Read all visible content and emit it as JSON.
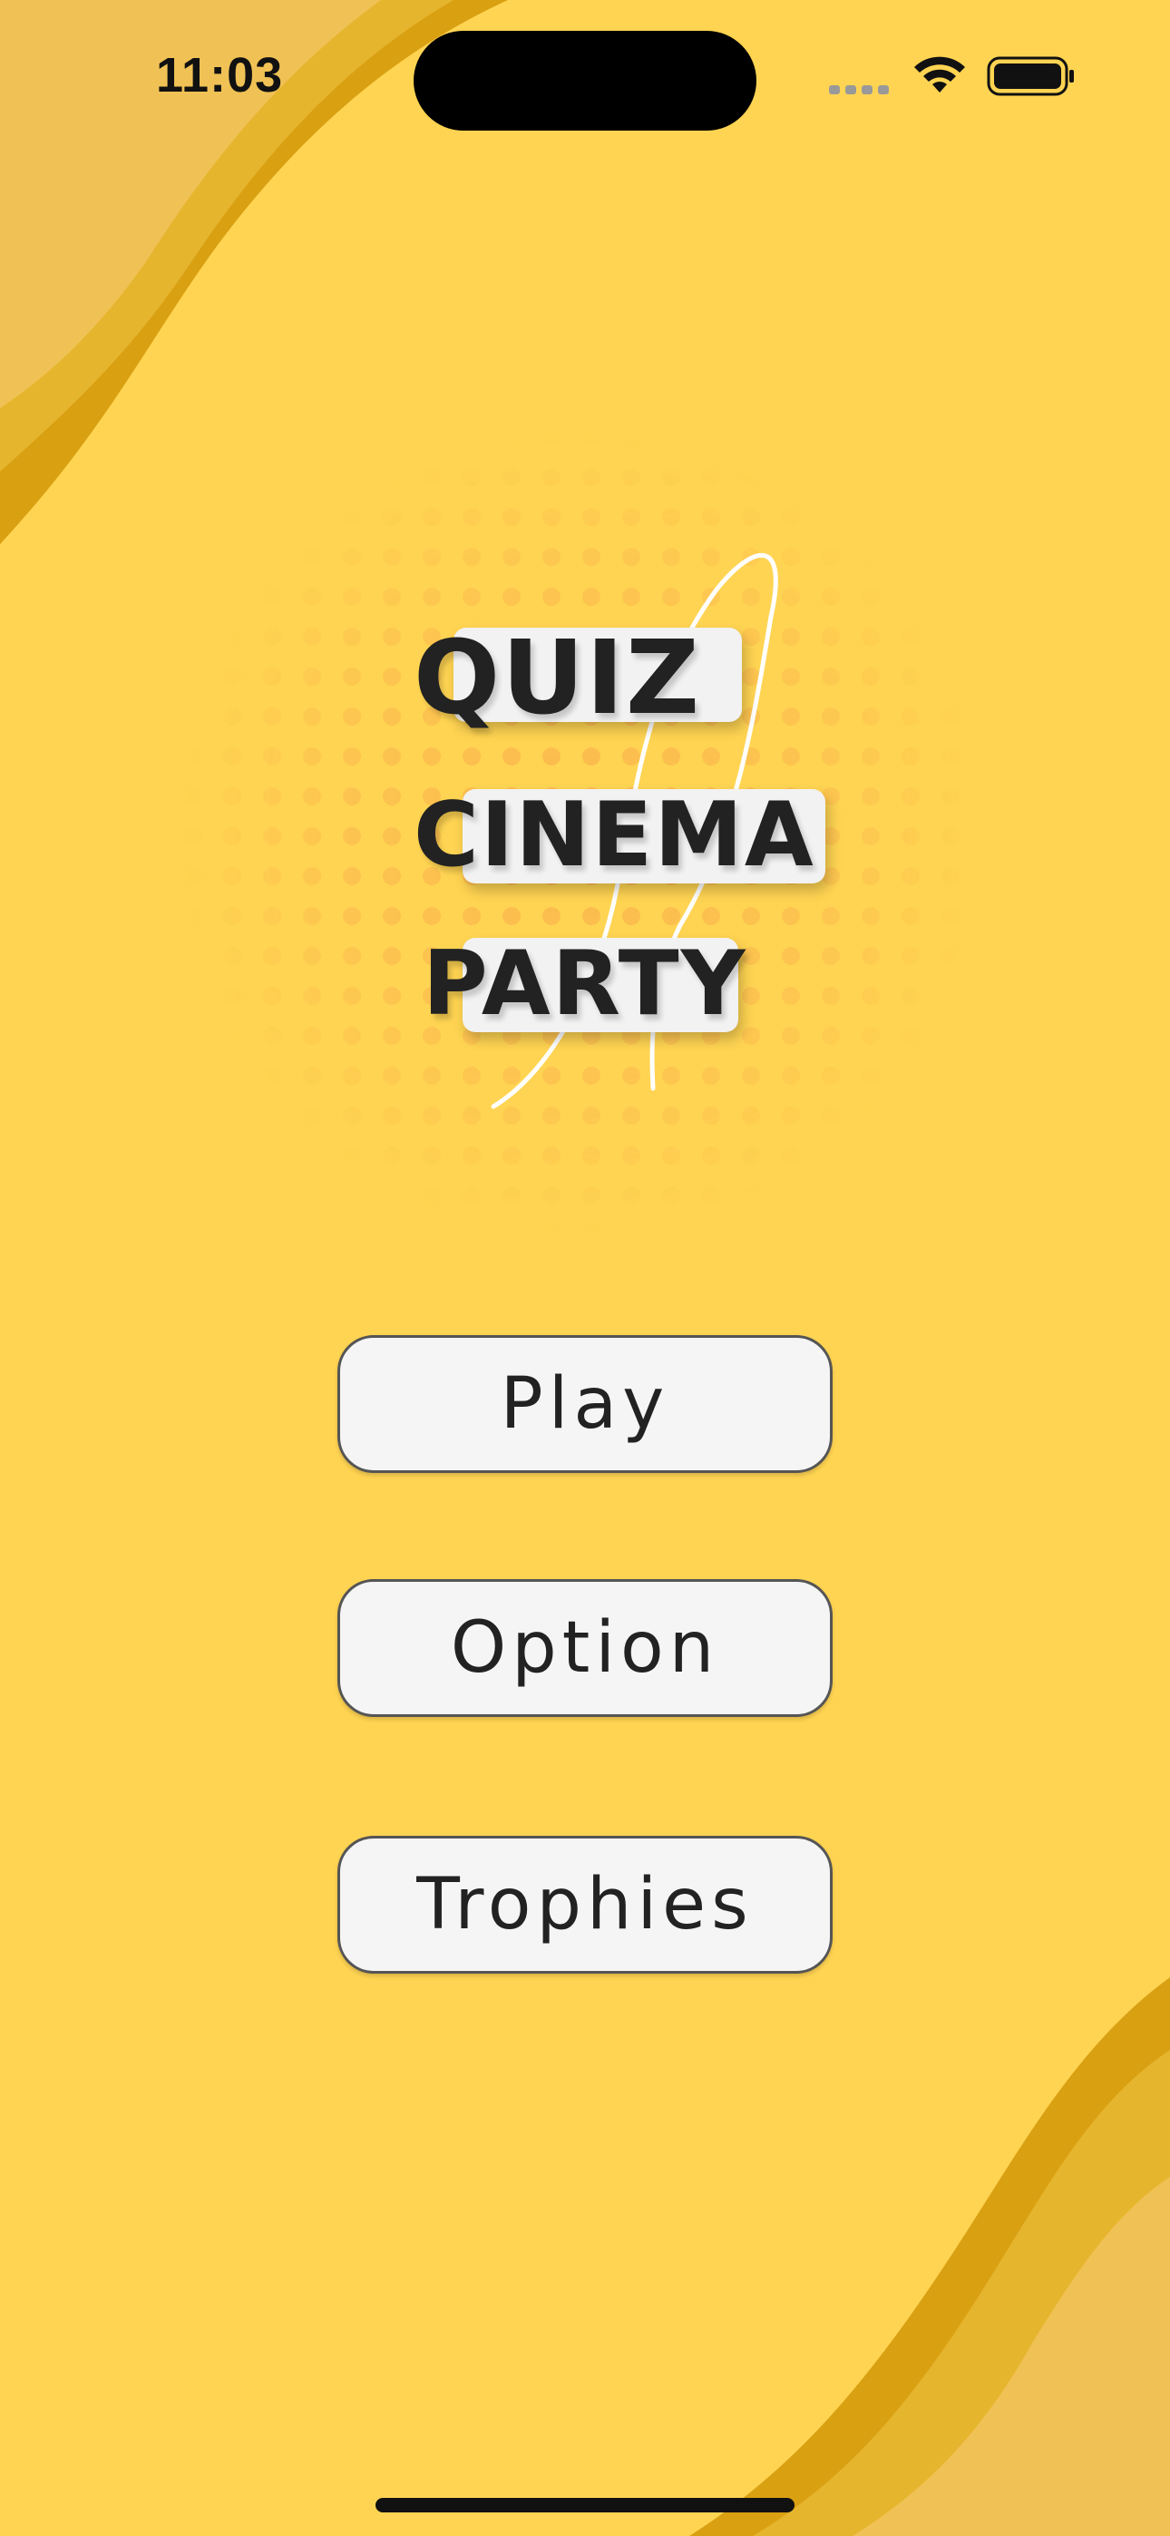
{
  "status_bar": {
    "time": "11:03",
    "icons": [
      "cellular-signal-icon",
      "wifi-icon",
      "battery-icon"
    ]
  },
  "logo": {
    "line1": "QUIZ",
    "line2": "CINEMA",
    "line3": "PARTY"
  },
  "menu": {
    "play_label": "Play",
    "option_label": "Option",
    "trophies_label": "Trophies"
  },
  "colors": {
    "background": "#FFD452",
    "wave_dark": "#D9A012",
    "wave_mid": "#E6B52E",
    "wave_light": "#F0C255",
    "button_fill": "#F5F5F5",
    "text": "#222222"
  }
}
